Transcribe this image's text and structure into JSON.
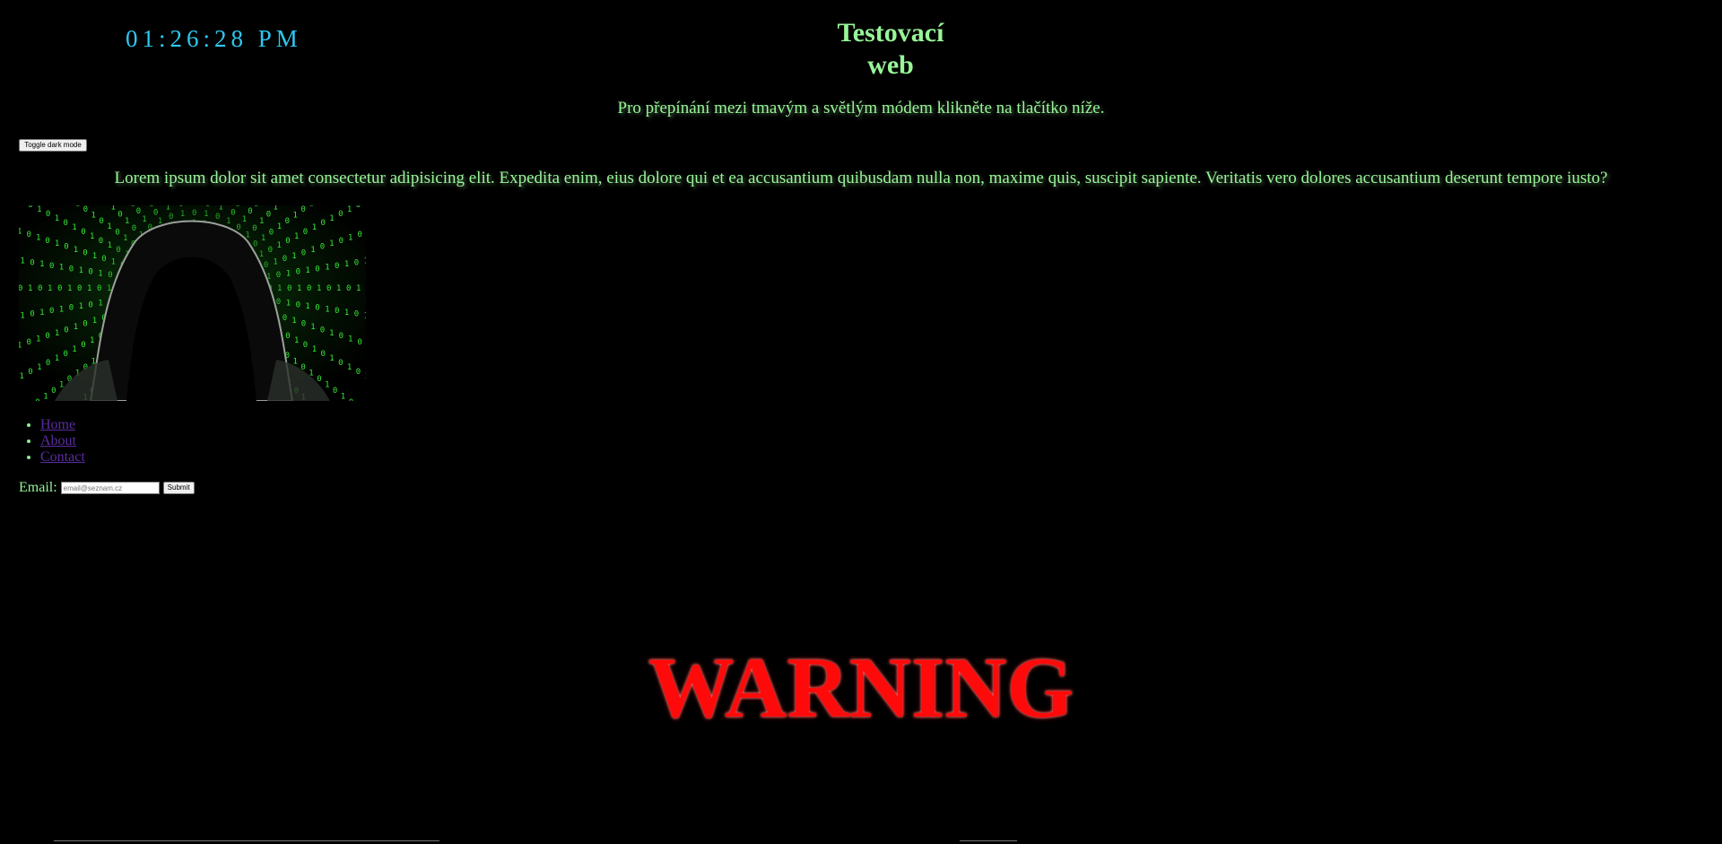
{
  "header": {
    "clock": "01:26:28 PM",
    "title": "Testovací web"
  },
  "intro": {
    "text": "Pro přepínání mezi tmavým a světlým módem klikněte na tlačítko níže.",
    "toggle_label": "Toggle dark mode"
  },
  "content": {
    "paragraph": "Lorem ipsum dolor sit amet consectetur adipisicing elit. Expedita enim, eius dolore qui et ea accusantium quibusdam nulla non, maxime quis, suscipit sapiente. Veritatis vero dolores accusantium deserunt tempore iusto?"
  },
  "nav": {
    "items": [
      "Home",
      "About",
      "Contact"
    ]
  },
  "form": {
    "email_label": "Email:",
    "email_placeholder": "email@seznam.cz",
    "email_value": "",
    "submit_label": "Submit"
  },
  "banner": {
    "warning_text": "WARNING"
  },
  "colors": {
    "background": "#000000",
    "text": "#98f598",
    "clock": "#2ec8f0",
    "link": "#5a2ca0",
    "warning": "#ff0a0a"
  }
}
